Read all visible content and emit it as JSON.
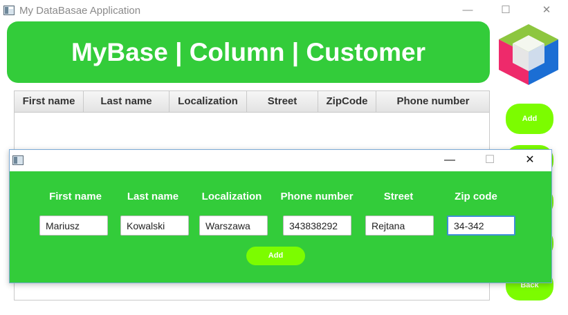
{
  "window": {
    "title": "My DataBasae Application"
  },
  "header": {
    "title": "MyBase | Column | Customer"
  },
  "table": {
    "columns": [
      "First name",
      "Last name",
      "Localization",
      "Street",
      "ZipCode",
      "Phone number"
    ],
    "rows": []
  },
  "side_buttons": {
    "add": "Add",
    "back": "Back"
  },
  "dialog": {
    "labels": [
      "First name",
      "Last name",
      "Localization",
      "Phone number",
      "Street",
      "Zip code"
    ],
    "values": [
      "Mariusz",
      "Kowalski",
      "Warszawa",
      "343838292",
      "Rejtana",
      "34-342"
    ],
    "add_label": "Add"
  },
  "colors": {
    "accent_green": "#33cc3a",
    "button_lime": "#7cfc00",
    "focus_blue": "#3f8ed8"
  },
  "icons": [
    "app-window-icon",
    "minimize-icon",
    "maximize-icon",
    "close-icon",
    "cube-logo"
  ]
}
